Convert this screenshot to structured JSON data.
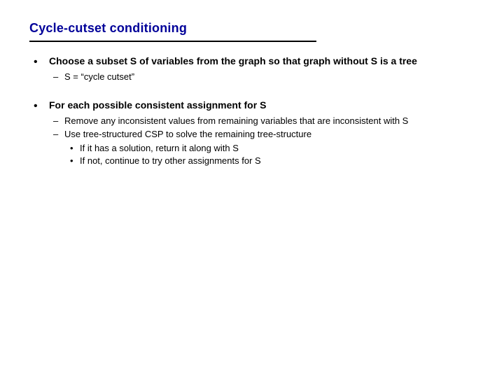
{
  "title": "Cycle-cutset conditioning",
  "bullets": [
    {
      "text": "Choose a subset S of variables from the graph so that graph without S is a tree",
      "sub": [
        {
          "text": "S = “cycle cutset”"
        }
      ]
    },
    {
      "text": "For each possible consistent assignment for S",
      "sub": [
        {
          "text": "Remove any inconsistent values from remaining variables that are inconsistent with S"
        },
        {
          "text": "Use tree-structured CSP to solve the remaining tree-structure",
          "subsub": [
            {
              "text": "If it has a solution, return it along with S"
            },
            {
              "text": "If not, continue to try other assignments for S"
            }
          ]
        }
      ]
    }
  ]
}
